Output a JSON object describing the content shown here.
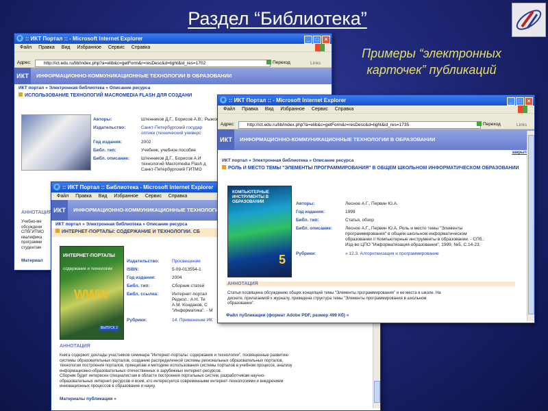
{
  "slide": {
    "title": "Раздел “Библиотека”",
    "subtitle_line1": "Примеры “электронных",
    "subtitle_line2": "карточек” публикаций"
  },
  "browser_common": {
    "menu": [
      "Файл",
      "Правка",
      "Вид",
      "Избранное",
      "Сервис",
      "Справка"
    ],
    "address_label": "Адрес:",
    "go_label": "Переход",
    "links_label": "Links",
    "site_logo": "ИКТ",
    "site_name": "ИНФОРМАЦИОННО-КОММУНИКАЦИОННЫЕ ТЕХНОЛОГИИ В ОБРАЗОВАНИИ",
    "breadcrumb": "ИКТ портал » Электронная библиотека » Описание ресурса"
  },
  "window1": {
    "title": ":: ИКТ Портал :: - Microsoft Internet Explorer",
    "url": "http://ict.edu.ru/lib/index.php?a=elib&c=getForm&r=resDesc&d=light&id_res=1702",
    "resource_title": "ИСПОЛЬЗОВАНИЕ ТЕХНОЛОГИЙ MACROMEDIA FLASH ДЛЯ СОЗДАНИ",
    "labels": [
      "Авторы:",
      "Издательство:",
      "Год издания:",
      "Библ. тип:",
      "Библ. описание:"
    ],
    "values": [
      "Штенников Д.Г., Борисов А.В., Рыжов",
      "Санкт-Петербургский государ",
      "оптики (технический универс",
      "2002",
      "Учебник, учебное пособие",
      "Штенников Д.Г., Борисов А.И",
      "технологий Macromedia Flash д",
      "Санкт-Петербургский ГИТМО"
    ],
    "annotation_head": "АННОТАЦИЯ",
    "annotation_lines": [
      "Учебно-ме",
      "обсуждени",
      "СПбГИТМО",
      "квалифика",
      "программи",
      "студентам"
    ],
    "bottom_link": "Материал"
  },
  "window2": {
    "title": ":: ИКТ Портал :: - Microsoft Internet Explorer",
    "url": "http://ict.edu.ru/lib/index.php?a=elib&c=getForm&r=resDesc&d=light&id_res=1735",
    "close_link": "закрыть",
    "resource_title": "РОЛЬ И МЕСТО ТЕМЫ \"ЭЛЕМЕНТЫ ПРОГРАММИРОВАНИЯ\" В ОБЩЕМ ШКОЛЬНОМ ИНФОРМАТИЧЕСКОМ ОБРАЗОВАНИИ",
    "labels": [
      "Авторы:",
      "Год издания:",
      "Библ. тип:",
      "Библ. описание:",
      "Рубрики:"
    ],
    "authors": "Лесное А.Г., Первин Ю.А.",
    "year": "1999",
    "bib_type": "Статья, обзор",
    "bib_desc": [
      "Лесное А.Г., Первин Ю.А. Роль и место темы \"Элементы",
      "программирования\" в общем школьном информатическом",
      "образовании // Компьютерные инструменты в образовании. - СПб.:",
      "Изд-во ЦПО \"Информатизация образования\", 1999, №5, С.14-23."
    ],
    "rubric": "» 12.3. Алгоритмизация и программирование",
    "cover_title": "КОМПЬЮТЕРНЫЕ ИНСТРУМЕНТЫ В ОБРАЗОВАНИИ",
    "cover_number": "5",
    "annotation_head": "АННОТАЦИЯ",
    "annotation_lines": [
      "Статья посвящена обсуждению общих концепций темы \"Элементы программирования\" и ее места в школе. На",
      "дискете, прилагаемой к журналу, приведена структура темы \"Элементы программирования в школьном",
      "образовании\"."
    ],
    "file_link": "Файл публикации (формат Adobe PDF, размер 499 Кб) »"
  },
  "window3": {
    "title": ":: ИКТ Портал :: Библиотека - Microsoft Internet Explorer",
    "resource_title": "ИНТЕРНЕТ-ПОРТАЛЫ: СОДЕРЖАНИЕ И ТЕХНОЛОГИИ. СБ",
    "labels": [
      "Издательство:",
      "ISBN:",
      "Год издания:",
      "Библ. тип:",
      "Библ. ссылка:",
      "Рубрики:"
    ],
    "publisher": "Просвещение",
    "isbn": "5-09-013554-1",
    "year": "2004",
    "bib_type": "Сборник статей",
    "bib_ref": [
      "Интернет-портал",
      "Редкол.: А.Н. Ти",
      "А.М. Кондаков, С",
      "\"Информатика\". - М"
    ],
    "rubric": "14. Применение ИК",
    "cover_title": "ИНТЕРНЕТ-ПОРТАЛЫ",
    "cover_sub": "содержание и технологии",
    "cover_www": "WWW",
    "cover_issue": "ВЫПУСК 2",
    "annotation_head": "АННОТАЦИЯ",
    "annotation_lines": [
      "Книга содержит доклады участников семинара \"Интернет-порталы: содержание и технологии\", посвященные развитию",
      "системы образовательных порталов, созданию распределенной системы региональных образовательных порталов,",
      "технологии построения порталов, принципам и методике использования системы порталов в учебном процессе, анализу",
      "информационно-образовательных отечественных и зарубежных интернет-ресурсов.",
      "Сборник будет интересен специалистам в области построения портальных систем, разработчикам научно-",
      "образовательных интернет-ресурсов и всем, кто интересуется современными интернет-технологиями и внедрением",
      "инновационных процессов в образование и науку."
    ],
    "bottom_link": "Материалы публикации »"
  }
}
